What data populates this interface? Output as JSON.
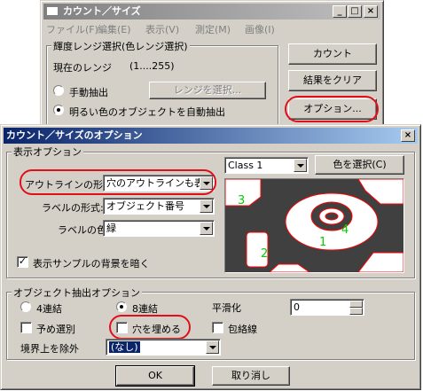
{
  "count_window": {
    "title": "カウント／サイズ",
    "menu": [
      "ファイル(F)",
      "編集(E)",
      "表示(V)",
      "測定(M)",
      "画像(I)"
    ],
    "range_group_label": "輝度レンジ選択(色レンジ選択)",
    "current_range_label": "現在のレンジ",
    "current_range_value": "(1....255)",
    "manual_label": "手動抽出",
    "auto_label": "明るい色のオブジェクトを自動抽出",
    "select_range_button": "レンジを選択...",
    "count_button": "カウント",
    "clear_button": "結果をクリア",
    "options_button": "オプション..."
  },
  "dialog": {
    "title": "カウント／サイズのオプション",
    "close_glyph": "×",
    "display_group_label": "表示オプション",
    "outline_label": "アウトラインの形式:",
    "outline_value": "穴のアウトラインも表示す",
    "label_format_label": "ラベルの形式:",
    "label_format_value": "オブジェクト番号",
    "label_color_label": "ラベルの色:",
    "label_color_value": "緑",
    "class_value": "Class 1",
    "select_color_button": "色を選択(C)",
    "darken_label": "表示サンプルの背景を暗く",
    "preview_numbers": [
      "3",
      "2",
      "1",
      "4"
    ],
    "extraction_group_label": "オブジェクト抽出オプション",
    "conn4_label": "4連結",
    "conn8_label": "8連結",
    "smoothing_label": "平滑化",
    "smoothing_value": "0",
    "preselect_label": "予め選別",
    "fill_holes_label": "穴を埋める",
    "convex_hull_label": "包絡線",
    "exclude_border_label": "境界上を除外",
    "exclude_border_value": "(なし)",
    "ok_button": "OK",
    "cancel_button": "取り消し"
  },
  "colors": {
    "annotation": "#e0101a",
    "preview_bg": "#404040",
    "preview_obj": "#ffffff",
    "preview_outline": "#ff0000",
    "preview_label": "#00d000"
  }
}
